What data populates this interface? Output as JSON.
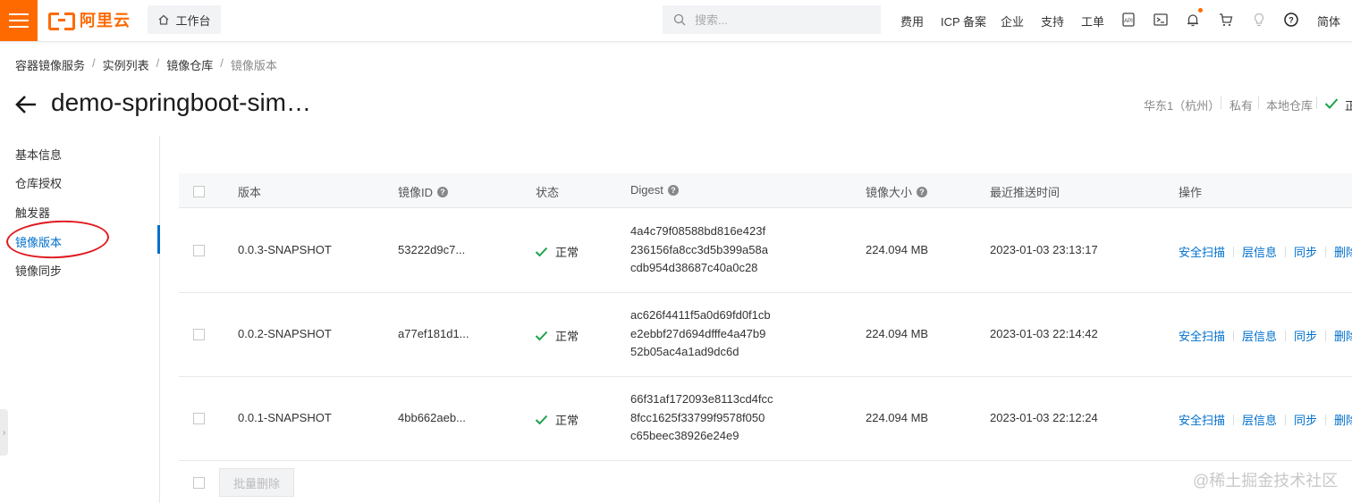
{
  "topbar": {
    "logo_text": "阿里云",
    "workbench_label": "工作台",
    "search_placeholder": "搜索...",
    "nav": [
      "费用",
      "ICP 备案",
      "企业",
      "支持",
      "工单"
    ],
    "language": "简体",
    "accent_color": "#ff6a00"
  },
  "breadcrumb": [
    "容器镜像服务",
    "实例列表",
    "镜像仓库",
    "镜像版本"
  ],
  "header": {
    "title": "demo-springboot-sim…",
    "region": "华东1（杭州）",
    "visibility": "私有",
    "repo_type": "本地仓库",
    "status_initial": "正"
  },
  "sidenav": {
    "items": [
      "基本信息",
      "仓库授权",
      "触发器",
      "镜像版本",
      "镜像同步"
    ],
    "active": "镜像版本",
    "active_color": "#0070cc"
  },
  "table": {
    "columns": [
      "版本",
      "镜像ID",
      "状态",
      "Digest",
      "镜像大小",
      "最近推送时间",
      "操作"
    ],
    "rows": [
      {
        "version": "0.0.3-SNAPSHOT",
        "image_id": "53222d9c7...",
        "status": "正常",
        "digest": [
          "4a4c79f08588bd816e423f",
          "236156fa8cc3d5b399a58a",
          "cdb954d38687c40a0c28"
        ],
        "size": "224.094 MB",
        "pushed": "2023-01-03 23:13:17"
      },
      {
        "version": "0.0.2-SNAPSHOT",
        "image_id": "a77ef181d1...",
        "status": "正常",
        "digest": [
          "ac626f4411f5a0d69fd0f1cb",
          "e2ebbf27d694dfffe4a47b9",
          "52b05ac4a1ad9dc6d"
        ],
        "size": "224.094 MB",
        "pushed": "2023-01-03 22:14:42"
      },
      {
        "version": "0.0.1-SNAPSHOT",
        "image_id": "4bb662aeb...",
        "status": "正常",
        "digest": [
          "66f31af172093e8113cd4fcc",
          "8fcc1625f33799f9578f050",
          "c65beec38926e24e9"
        ],
        "size": "224.094 MB",
        "pushed": "2023-01-03 22:12:24"
      }
    ],
    "actions": [
      "安全扫描",
      "层信息",
      "同步",
      "删除"
    ],
    "batch_delete_label": "批量删除",
    "status_color": "#1aa34a",
    "link_color": "#0070cc"
  },
  "watermark": "@稀土掘金技术社区"
}
